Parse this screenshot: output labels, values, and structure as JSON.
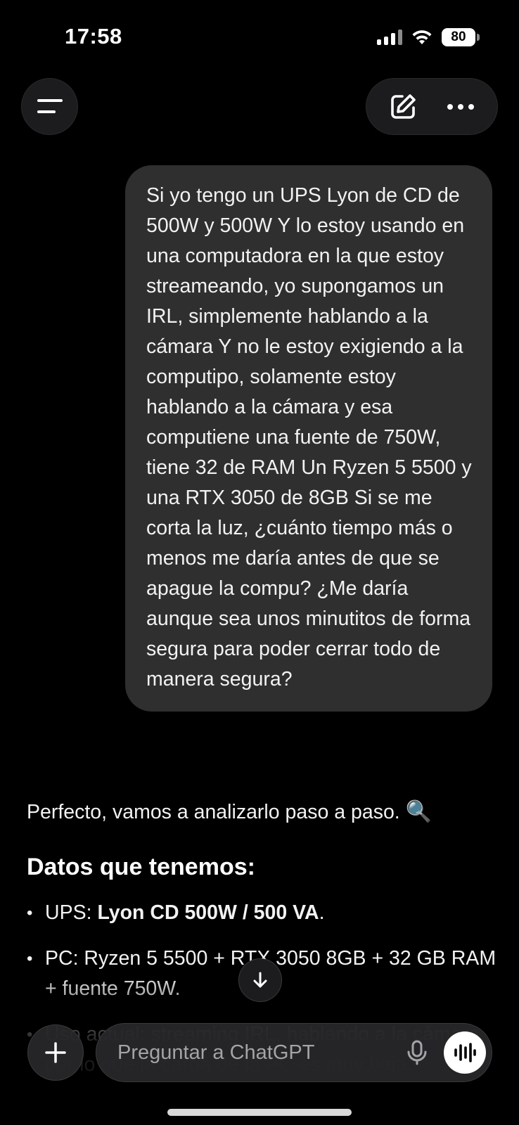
{
  "status_bar": {
    "time": "17:58",
    "battery": "80"
  },
  "user_message": "Si yo tengo un UPS Lyon de CD de 500W y 500W Y lo estoy usando en una computadora en la que estoy streameando, yo supongamos un IRL, simplemente hablando a la cámara Y no le estoy exigiendo a la computipo, solamente estoy hablando a la cámara y esa computiene una fuente de 750W, tiene 32 de RAM Un Ryzen 5 5500 y una RTX 3050 de 8GB Si se me corta la luz, ¿cuánto tiempo más o menos me daría antes de que se apague la compu? ¿Me daría aunque sea unos minutitos de forma segura para poder cerrar todo de manera segura?",
  "assistant": {
    "intro": "Perfecto, vamos a analizarlo paso a paso.",
    "intro_emoji": "🔍",
    "section_title": "Datos que tenemos:",
    "bullet_1_prefix": "UPS: ",
    "bullet_1_bold": "Lyon CD 500W / 500 VA",
    "bullet_1_suffix": ".",
    "bullet_2": "PC: Ryzen 5 5500 + RTX 3050 8GB + 32 GB RAM + fuente 750W.",
    "bullet_3": "Uso actual: streaming IRL, hablando a la cámara, por lo que la carga de la PC es muy baja."
  },
  "composer": {
    "placeholder": "Preguntar a ChatGPT"
  },
  "icons": {
    "menu": "menu-icon",
    "new_chat": "new-chat-icon",
    "more": "more-icon",
    "scroll_down": "arrow-down-icon",
    "plus": "plus-icon",
    "mic": "microphone-icon",
    "voice": "voice-waveform-icon"
  }
}
